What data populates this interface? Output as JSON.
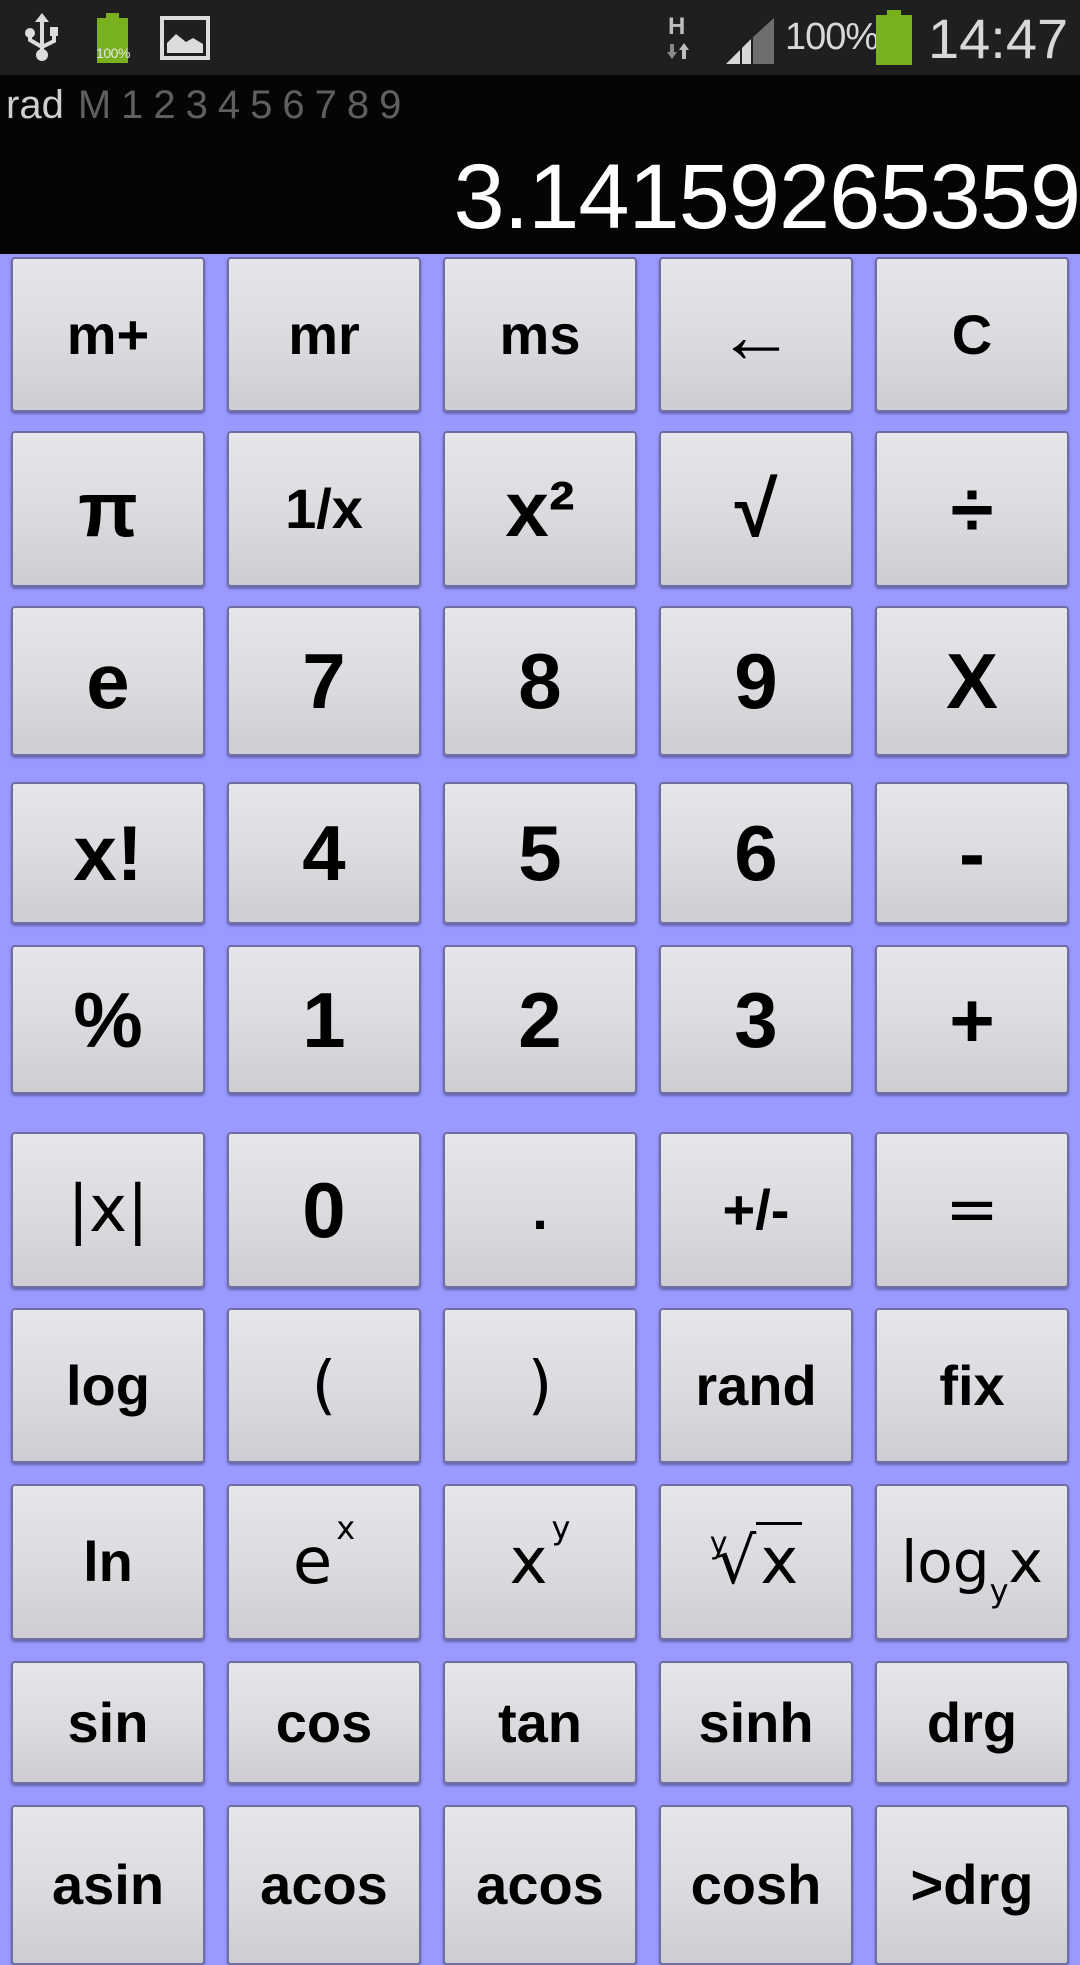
{
  "status_bar": {
    "left_icons": [
      "usb-icon",
      "battery-icon",
      "gallery-icon"
    ],
    "small_battery_label": "100%",
    "network_type": "H",
    "battery_percent": "100%",
    "time": "14:47",
    "colors": {
      "battery": "#79b01d",
      "background": "#1f1f1f"
    }
  },
  "display": {
    "angle_mode": "rad",
    "memory_indicators": [
      "M",
      "1",
      "2",
      "3",
      "4",
      "5",
      "6",
      "7",
      "8",
      "9"
    ],
    "value": "3.14159265359"
  },
  "colors": {
    "keypad_background": "#9999ff",
    "key_face": "#dcdce0",
    "key_border": "#6e6ea2",
    "display_background": "#050505"
  },
  "keys": [
    [
      {
        "label": "m+",
        "id": "m-plus"
      },
      {
        "label": "mr",
        "id": "mr"
      },
      {
        "label": "ms",
        "id": "ms"
      },
      {
        "label": "←",
        "id": "backspace"
      },
      {
        "label": "C",
        "id": "clear"
      }
    ],
    [
      {
        "label": "π",
        "id": "pi"
      },
      {
        "label": "1/x",
        "id": "reciprocal"
      },
      {
        "label": "x²",
        "id": "square"
      },
      {
        "label": "√",
        "id": "sqrt"
      },
      {
        "label": "÷",
        "id": "divide"
      }
    ],
    [
      {
        "label": "e",
        "id": "e"
      },
      {
        "label": "7",
        "id": "7"
      },
      {
        "label": "8",
        "id": "8"
      },
      {
        "label": "9",
        "id": "9"
      },
      {
        "label": "X",
        "id": "multiply"
      }
    ],
    [
      {
        "label": "x!",
        "id": "factorial"
      },
      {
        "label": "4",
        "id": "4"
      },
      {
        "label": "5",
        "id": "5"
      },
      {
        "label": "6",
        "id": "6"
      },
      {
        "label": "-",
        "id": "subtract"
      }
    ],
    [
      {
        "label": "%",
        "id": "percent"
      },
      {
        "label": "1",
        "id": "1"
      },
      {
        "label": "2",
        "id": "2"
      },
      {
        "label": "3",
        "id": "3"
      },
      {
        "label": "+",
        "id": "add"
      }
    ],
    [
      {
        "label": "|x|",
        "id": "abs"
      },
      {
        "label": "0",
        "id": "0"
      },
      {
        "label": ".",
        "id": "decimal"
      },
      {
        "label": "+/-",
        "id": "negate"
      },
      {
        "label": "=",
        "id": "equals"
      }
    ],
    [
      {
        "label": "log",
        "id": "log"
      },
      {
        "label": "(",
        "id": "open-paren"
      },
      {
        "label": ")",
        "id": "close-paren"
      },
      {
        "label": "rand",
        "id": "rand"
      },
      {
        "label": "fix",
        "id": "fix"
      }
    ],
    [
      {
        "label": "ln",
        "id": "ln"
      },
      {
        "label": "e",
        "sup": "x",
        "id": "exp"
      },
      {
        "label": "x",
        "sup": "y",
        "id": "power"
      },
      {
        "label": "x",
        "index": "y",
        "id": "nth-root"
      },
      {
        "label": "log",
        "sub": "y",
        "tail": "x",
        "id": "log-base"
      }
    ],
    [
      {
        "label": "sin",
        "id": "sin"
      },
      {
        "label": "cos",
        "id": "cos"
      },
      {
        "label": "tan",
        "id": "tan"
      },
      {
        "label": "sinh",
        "id": "sinh"
      },
      {
        "label": "drg",
        "id": "drg"
      }
    ],
    [
      {
        "label": "asin",
        "id": "asin"
      },
      {
        "label": "acos",
        "id": "acos"
      },
      {
        "label": "acos",
        "id": "acos-2"
      },
      {
        "label": "cosh",
        "id": "cosh"
      },
      {
        "label": ">drg",
        "id": "to-drg"
      }
    ]
  ]
}
